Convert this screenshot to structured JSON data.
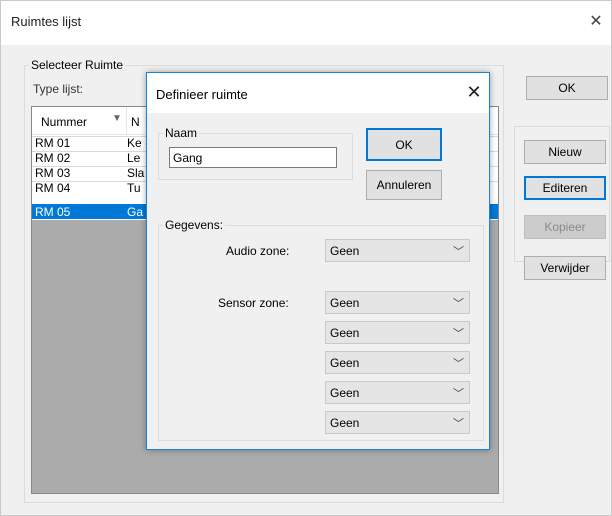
{
  "main": {
    "title": "Ruimtes lijst",
    "close_glyph": "✕",
    "group_label": "Selecteer Ruimte",
    "type_label": "Type lijst:",
    "ok_label": "OK",
    "nieuw_label": "Nieuw",
    "editeren_label": "Editeren",
    "kopieer_label": "Kopieer",
    "verwijder_label": "Verwijder"
  },
  "list": {
    "columns": [
      "Nummer",
      "N"
    ],
    "sort_glyph": "▼",
    "rows": [
      {
        "nummer": "RM 01",
        "naam": "Ke",
        "selected": false
      },
      {
        "nummer": "RM 02",
        "naam": "Le",
        "selected": false
      },
      {
        "nummer": "RM 03",
        "naam": "Sla",
        "selected": false
      },
      {
        "nummer": "RM 04",
        "naam": "Tu",
        "selected": false
      },
      {
        "nummer": "RM 05",
        "naam": "Ga",
        "selected": true
      }
    ]
  },
  "dialog": {
    "title": "Definieer ruimte",
    "close_glyph": "✕",
    "naam_group": "Naam",
    "naam_value": "Gang",
    "ok_label": "OK",
    "cancel_label": "Annuleren",
    "gegevens_group": "Gegevens:",
    "audio_label": "Audio zone:",
    "sensor_label": "Sensor zone:",
    "audio_zone": "Geen",
    "sensor_zones": [
      "Geen",
      "Geen",
      "Geen",
      "Geen",
      "Geen"
    ],
    "dropdown_arrow": "﹀"
  },
  "colors": {
    "selection": "#0078d7",
    "dialog_border": "#1883d7"
  }
}
